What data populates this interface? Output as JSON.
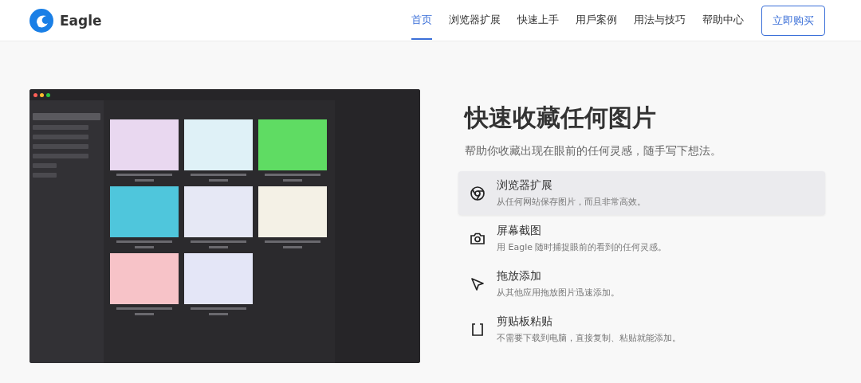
{
  "header": {
    "brand": "Eagle",
    "nav": [
      {
        "label": "首页",
        "selected": true
      },
      {
        "label": "浏览器扩展",
        "selected": false
      },
      {
        "label": "快速上手",
        "selected": false
      },
      {
        "label": "用戶案例",
        "selected": false
      },
      {
        "label": "用法与技巧",
        "selected": false
      },
      {
        "label": "帮助中心",
        "selected": false
      }
    ],
    "cta": "立即购买"
  },
  "hero": {
    "title": "快速收藏任何图片",
    "subtitle": "帮助你收藏出现在眼前的任何灵感，随手写下想法。",
    "features": [
      {
        "kind": "chrome",
        "title": "浏览器扩展",
        "text": "从任何网站保存图片，而且非常高效。",
        "selected": true
      },
      {
        "kind": "camera",
        "title": "屏幕截图",
        "text": "用 Eagle 随时捕捉眼前的看到的任何灵感。",
        "selected": false
      },
      {
        "kind": "cursor",
        "title": "拖放添加",
        "text": "从其他应用拖放图片迅速添加。",
        "selected": false
      },
      {
        "kind": "clipboard",
        "title": "剪贴板粘贴",
        "text": "不需要下载到电脑，直接复制、粘贴就能添加。",
        "selected": false
      }
    ]
  }
}
